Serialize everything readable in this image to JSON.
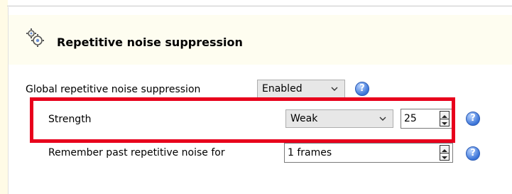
{
  "section": {
    "title": "Repetitive noise suppression",
    "icon": "gears-icon"
  },
  "global": {
    "label": "Global repetitive noise suppression",
    "selected": "Enabled",
    "help_glyph": "?"
  },
  "strength": {
    "label": "Strength",
    "selected": "Weak",
    "value": "25",
    "help_glyph": "?"
  },
  "remember": {
    "label": "Remember past repetitive noise for",
    "value": "1 frames",
    "help_glyph": "?"
  },
  "colors": {
    "highlight": "#e8001c",
    "help_blue": "#3b74d8",
    "header_bg": "#fefdf0"
  }
}
